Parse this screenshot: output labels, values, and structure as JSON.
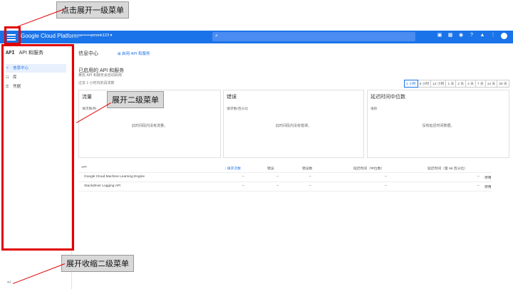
{
  "annotations": {
    "expand_first_level": "点击展开一级菜单",
    "expand_second_level": "展开二级菜单",
    "expand_collapse_second_level": "展开收缩二级菜单"
  },
  "topbar": {
    "brand": "Google Cloud Platform",
    "project": "se••••••pmonk123 ▾",
    "search_icon": "⌕"
  },
  "sidebar": {
    "api_badge": "API",
    "title": "API 和服务",
    "items": [
      {
        "label": "信息中心",
        "icon": "✧"
      },
      {
        "label": "库",
        "icon": "☷"
      },
      {
        "label": "凭据",
        "icon": "⚿"
      }
    ],
    "collapse_icon": "«ı"
  },
  "main": {
    "page_title": "信息中心",
    "enable_api": "启用 API 和服务",
    "section_title": "已启用的 API 和服务",
    "section_subtitle": "某些 API 和服务会自动启用",
    "range_label": "过去 1 小时内的请求数",
    "time_ranges": [
      "1 小时",
      "6 小时",
      "12 小时",
      "1 天",
      "2 天",
      "4 天",
      "7 天",
      "14 天",
      "30 天"
    ],
    "cards": [
      {
        "title": "流量",
        "subtitle": "请求数/秒",
        "empty": "此时间段内没有流量。"
      },
      {
        "title": "错误",
        "subtitle": "请求数/百分比",
        "empty": "此时间段内没有错误。"
      },
      {
        "title": "延迟时间中位数",
        "subtitle": "毫秒",
        "empty": "没有延迟时间数据。"
      }
    ],
    "table": {
      "headers": [
        "API",
        "↓ 请求次数",
        "错误",
        "错误数",
        "延迟时间（中位数）",
        "延迟时间（第 98 百分位）"
      ],
      "rows": [
        {
          "name": "Google Cloud Machine Learning Engine",
          "requests": "–",
          "errors": "–",
          "error_rate": "–",
          "latency_median": "–",
          "latency_p98": "–",
          "action": "停用"
        },
        {
          "name": "Stackdriver Logging API",
          "requests": "–",
          "errors": "–",
          "error_rate": "–",
          "latency_median": "–",
          "latency_p98": "–",
          "action": "停用"
        }
      ]
    }
  },
  "colors": {
    "accent": "#1a73e8",
    "annotation_red": "#e00000",
    "callout_bg": "#d8d8d8"
  }
}
